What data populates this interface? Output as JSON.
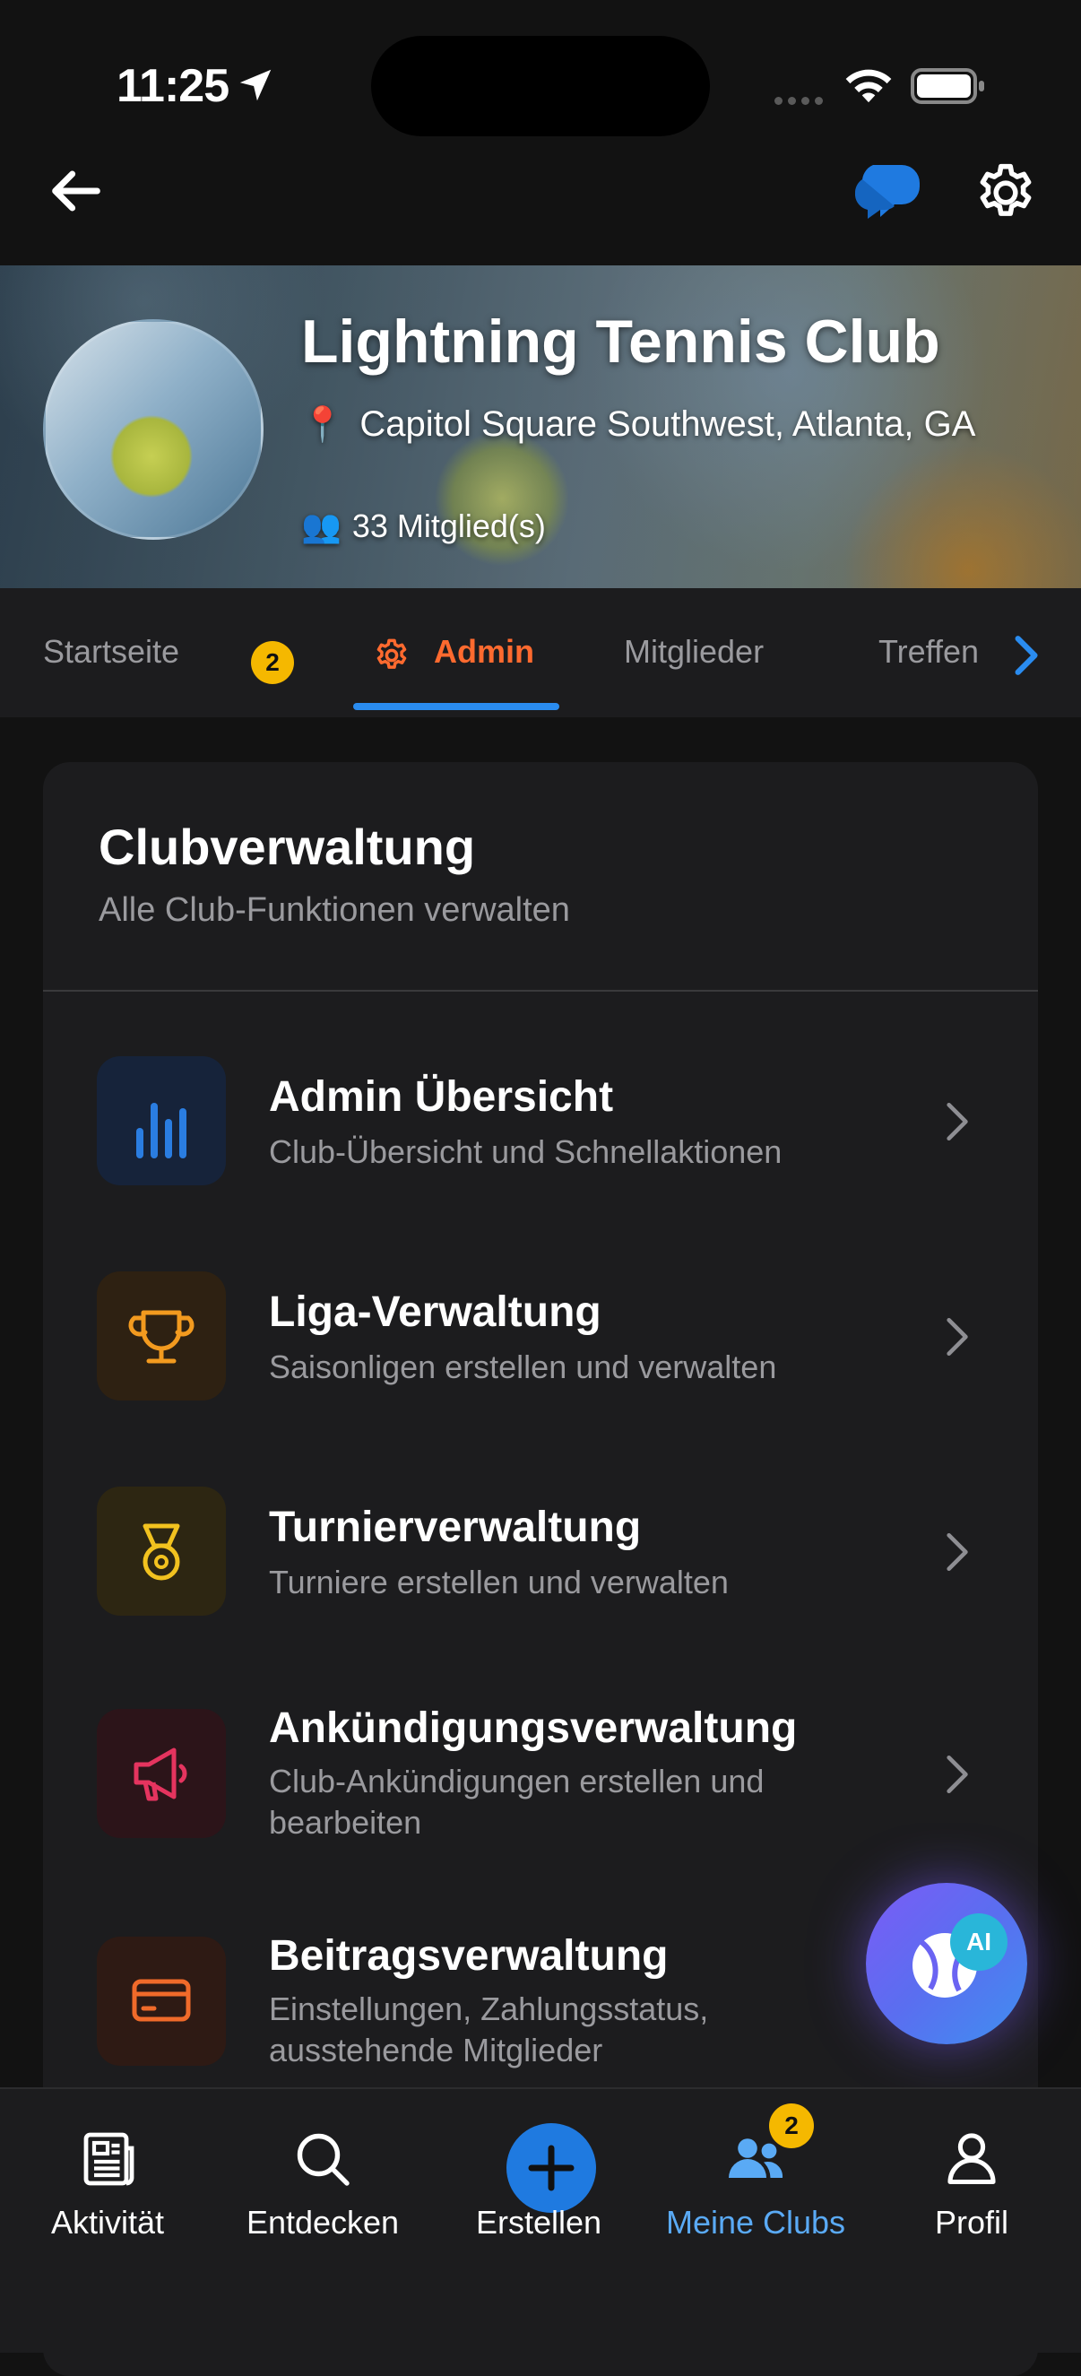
{
  "status_bar": {
    "time": "11:25"
  },
  "club": {
    "name": "Lightning Tennis Club",
    "location": "Capitol Square Southwest, Atlanta, GA",
    "members": "33 Mitglied(s)"
  },
  "tabs": {
    "home": "Startseite",
    "home_badge": "2",
    "admin": "Admin",
    "members": "Mitglieder",
    "meetings": "Treffen"
  },
  "admin_card": {
    "title": "Clubverwaltung",
    "subtitle": "Alle Club-Funktionen verwalten",
    "items": [
      {
        "title": "Admin Übersicht",
        "desc": "Club-Übersicht und Schnellaktionen",
        "icon": "bar-chart-icon",
        "color": "#2a7de1"
      },
      {
        "title": "Liga-Verwaltung",
        "desc": "Saisonligen erstellen und verwalten",
        "icon": "trophy-icon",
        "color": "#f29a1f"
      },
      {
        "title": "Turnierverwaltung",
        "desc": "Turniere erstellen und verwalten",
        "icon": "medal-icon",
        "color": "#f2c21f"
      },
      {
        "title": "Ankündigungsverwaltung",
        "desc": "Club-Ankündigungen erstellen und bearbeiten",
        "icon": "megaphone-icon",
        "color": "#e5345f"
      },
      {
        "title": "Beitragsverwaltung",
        "desc": "Einstellungen, Zahlungsstatus, ausstehende Mitglieder",
        "icon": "credit-card-icon",
        "color": "#f06a2a"
      }
    ]
  },
  "ai_fab": {
    "badge": "AI"
  },
  "bottom_nav": {
    "activity": "Aktivität",
    "discover": "Entdecken",
    "create": "Erstellen",
    "my_clubs": "Meine Clubs",
    "my_clubs_badge": "2",
    "profile": "Profil"
  },
  "colors": {
    "accent": "#ff6a2f",
    "link": "#2a8cf0",
    "badge": "#f5b800",
    "active_nav": "#5aaaf5"
  }
}
